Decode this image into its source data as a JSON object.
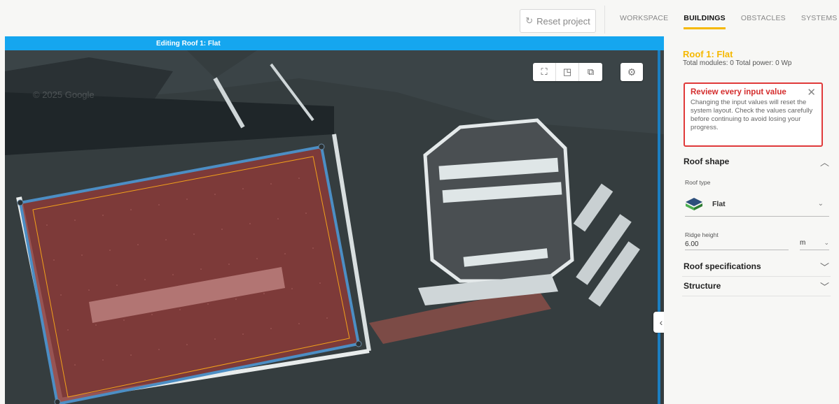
{
  "toolbar": {
    "reset_label": "Reset project",
    "reset_icon": "refresh-icon"
  },
  "tabs": [
    {
      "label": "WORKSPACE",
      "active": false
    },
    {
      "label": "BUILDINGS",
      "active": true
    },
    {
      "label": "OBSTACLES",
      "active": false
    },
    {
      "label": "SYSTEMS",
      "active": false
    }
  ],
  "map": {
    "banner": "Editing Roof 1: Flat",
    "watermark": "© 2025 Google",
    "tools": [
      "fullscreen-icon",
      "3d-view-icon",
      "camera-icon",
      "settings-icon"
    ]
  },
  "panel": {
    "title": "Roof 1: Flat",
    "summary": "Total modules: 0 Total power: 0 Wp",
    "alert": {
      "title": "Review every input value",
      "body": "Changing the input values will reset the system layout. Check the values carefully before continuing to avoid losing your progress."
    },
    "sections": {
      "roof_shape": "Roof shape",
      "roof_specs": "Roof specifications",
      "structure": "Structure"
    },
    "roof_type": {
      "label": "Roof type",
      "value": "Flat"
    },
    "ridge_height": {
      "label": "Ridge height",
      "value": "6.00",
      "unit": "m"
    }
  },
  "colors": {
    "accent": "#f5b800",
    "banner": "#15a6ef",
    "alert": "#e03a3a",
    "roof_fill": "#8a3a38"
  }
}
